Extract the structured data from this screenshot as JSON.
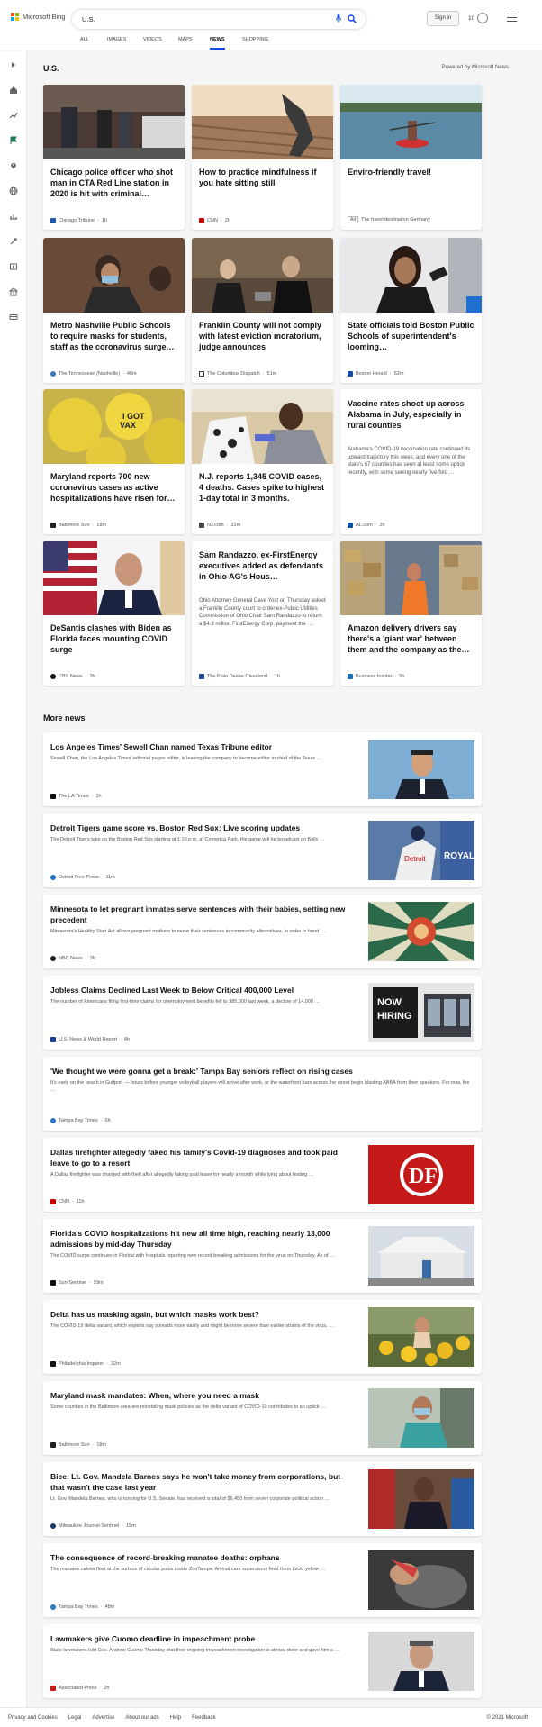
{
  "header": {
    "brand": "Microsoft Bing",
    "search_value": "U.S.",
    "signin_label": "Sign in",
    "rewards_count": "10",
    "tabs": [
      {
        "label": "ALL"
      },
      {
        "label": "IMAGES"
      },
      {
        "label": "VIDEOS"
      },
      {
        "label": "MAPS"
      },
      {
        "label": "NEWS"
      },
      {
        "label": "SHOPPING"
      }
    ],
    "active_tab": "NEWS",
    "accent": "#174ae4"
  },
  "section": {
    "title": "U.S.",
    "powered_by": "Powered by Microsoft News"
  },
  "cards": [
    {
      "title": "Chicago police officer who shot man in CTA Red Line station in 2020 is hit with criminal…",
      "source": "Chicago Tribune",
      "time": "1h"
    },
    {
      "title": "How to practice mindfulness if you hate sitting still",
      "source": "CNN",
      "time": "2h"
    },
    {
      "title": "Enviro-friendly travel!",
      "ad_label": "Ad",
      "source": "The travel destination Germany"
    },
    {
      "title": "Metro Nashville Public Schools to require masks for students, staff as the coronavirus surge…",
      "source": "The Tennessean (Nashville)",
      "time": "46m"
    },
    {
      "title": "Franklin County will not comply with latest eviction moratorium, judge announces",
      "source": "The Columbus Dispatch",
      "time": "51m"
    },
    {
      "title": "State officials told Boston Public Schools of superintendent's looming…",
      "source": "Boston Herald",
      "time": "52m"
    },
    {
      "title": "Maryland reports 700 new coronavirus cases as active hospitalizations have risen for…",
      "source": "Baltimore Sun",
      "time": "18m"
    },
    {
      "title": "N.J. reports 1,345 COVID cases, 4 deaths. Cases spike to highest 1-day total in 3 months.",
      "source": "NJ.com",
      "time": "31m"
    },
    {
      "title": "Vaccine rates shoot up across Alabama in July, especially in rural counties",
      "desc": "Alabama's COVID-19 vaccination rate continued its upward trajectory this week, and every one of the state's 67 counties has seen at least some uptick recently, with some seeing nearly five-fold …",
      "source": "AL.com",
      "time": "2h"
    },
    {
      "title": "DeSantis clashes with Biden as Florida faces mounting COVID surge",
      "source": "CBS News",
      "time": "3h"
    },
    {
      "title": "Sam Randazzo, ex-FirstEnergy executives added as defendants in Ohio AG's Hous…",
      "desc": "Ohio Attorney General Dave Yost on Thursday asked a Franklin County court to order ex-Public Utilities Commission of Ohio Chair Sam Randazzo to return a $4.3 million FirstEnergy Corp. payment the …",
      "source": "The Plain Dealer Cleveland",
      "time": "1h"
    },
    {
      "title": "Amazon delivery drivers say there's a 'giant war' between them and the company as the…",
      "source": "Business Insider",
      "time": "5h"
    }
  ],
  "more_news": {
    "title": "More news",
    "items": [
      {
        "title": "Los Angeles Times' Sewell Chan named Texas Tribune editor",
        "desc": "Sewell Chan, the Los Angeles Times' editorial pages editor, is leaving the company to become editor in chief of the Texas …",
        "source": "The LA Times",
        "time": "1h"
      },
      {
        "title": "Detroit Tigers game score vs. Boston Red Sox: Live scoring updates",
        "desc": "The Detroit Tigers take on the Boston Red Sox starting at 1:10 p.m. at Comerica Park, the game will be broadcast on Bally …",
        "source": "Detroit Free Press",
        "time": "11m"
      },
      {
        "title": "Minnesota to let pregnant inmates serve sentences with their babies, setting new precedent",
        "desc": "Minnesota's Healthy Start Act allows pregnant mothers to serve their sentences in community alternatives, in order to bond …",
        "source": "NBC News",
        "time": "2h"
      },
      {
        "title": "Jobless Claims Declined Last Week to Below Critical 400,000 Level",
        "desc": "The number of Americans filing first-time claims for unemployment benefits fell to 385,000 last week, a decline of 14,000 …",
        "source": "U.S. News & World Report",
        "time": "4h"
      },
      {
        "title": "'We thought we were gonna get a break:' Tampa Bay seniors reflect on rising cases",
        "desc": "It's early on the beach in Gulfport — hours before younger volleyball players will arrive after work, or the waterfront bars across the street begin blasting ABBA from their speakers. For now, the …",
        "source": "Tampa Bay Times",
        "time": "6h"
      },
      {
        "title": "Dallas firefighter allegedly faked his family's Covid-19 diagnoses and took paid leave to go to a resort",
        "desc": "A Dallas firefighter was charged with theft after allegedly taking paid leave for nearly a month while lying about testing …",
        "source": "CNN",
        "time": "11h"
      },
      {
        "title": "Florida's COVID hospitalizations hit new all time high, reaching nearly 13,000 admissions by mid-day Thursday",
        "desc": "The COVID surge continues in Florida with hospitals reporting new record-breaking admissions for the virus on Thursday. As of …",
        "source": "Sun Sentinel",
        "time": "59m"
      },
      {
        "title": "Delta has us masking again, but which masks work best?",
        "desc": "The COVID-19 delta variant, which experts say spreads more easily and might be more severe than earlier strains of the virus, …",
        "source": "Philadelphia Inquirer",
        "time": "32m"
      },
      {
        "title": "Maryland mask mandates: When, where you need a mask",
        "desc": "Some counties in the Baltimore area are reinstating mask policies as the delta variant of COVID-19 contributes to an uptick …",
        "source": "Baltimore Sun",
        "time": "18m"
      },
      {
        "title": "Bice: Lt. Gov. Mandela Barnes says he won't take money from corporations, but that wasn't the case last year",
        "desc": "Lt. Gov. Mandela Barnes, who is running for U.S. Senate, has received a total of $6,450 from seven corporate political action …",
        "source": "Milwaukee Journal-Sentinel",
        "time": "15m"
      },
      {
        "title": "The consequence of record-breaking manatee deaths: orphans",
        "desc": "The manatee calves float at the surface of circular pools inside ZooTampa. Animal care supervisors feed them thick, yellow …",
        "source": "Tampa Bay Times",
        "time": "48m"
      },
      {
        "title": "Lawmakers give Cuomo deadline in impeachment probe",
        "desc": "State lawmakers told Gov. Andrew Cuomo Thursday that their ongoing impeachment investigation is almost done and gave him a …",
        "source": "Associated Press",
        "time": "2h"
      }
    ]
  },
  "footer": {
    "links": [
      "Privacy and Cookies",
      "Legal",
      "Advertise",
      "About our ads",
      "Help",
      "Feedback"
    ],
    "copyright": "© 2021 Microsoft"
  }
}
